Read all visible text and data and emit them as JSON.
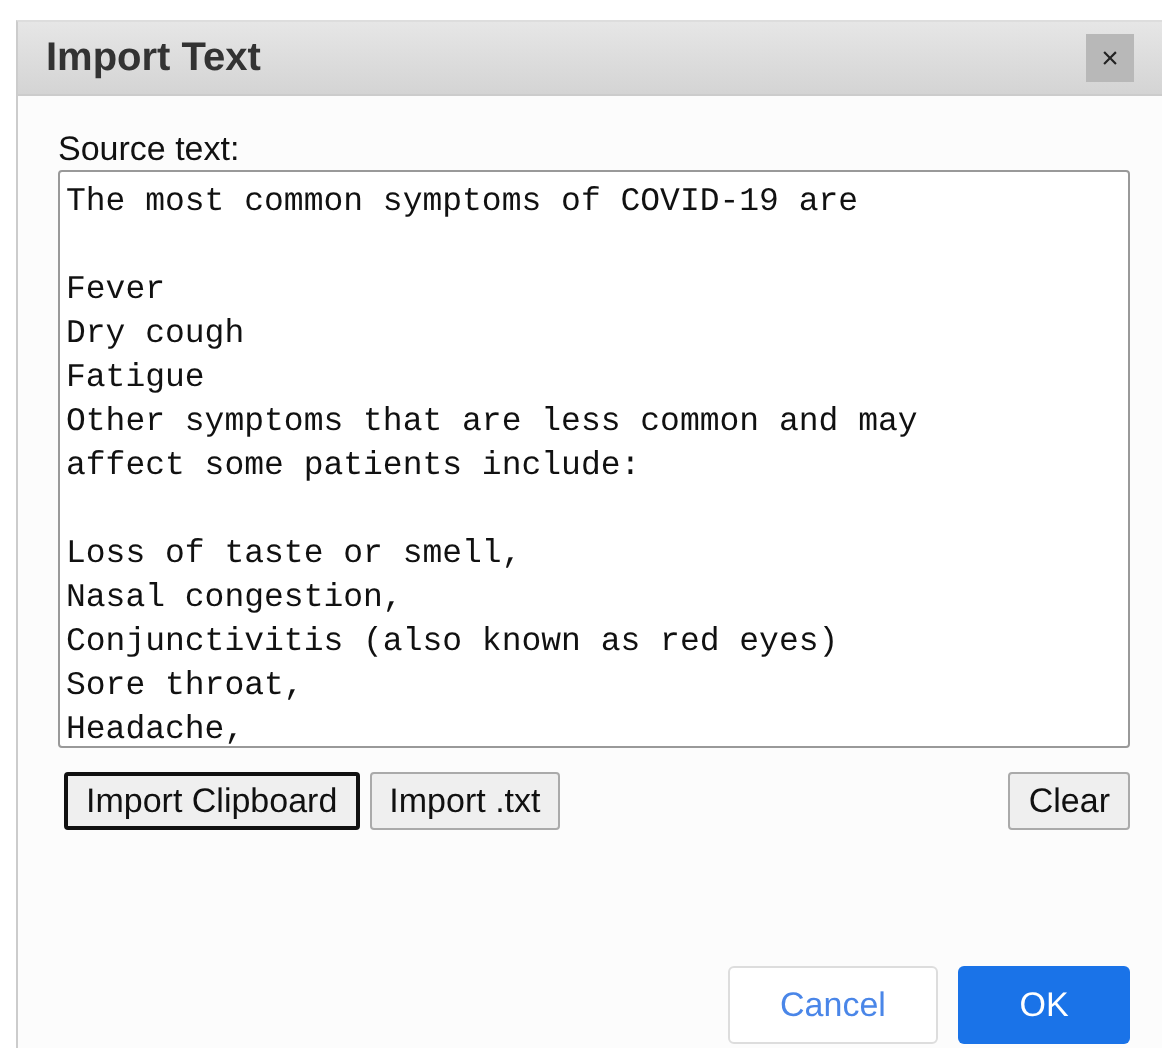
{
  "dialog": {
    "title": "Import Text",
    "close": "×"
  },
  "source": {
    "label": "Source text:",
    "value": "The most common symptoms of COVID-19 are\n\nFever\nDry cough\nFatigue\nOther symptoms that are less common and may\naffect some patients include:\n\nLoss of taste or smell,\nNasal congestion,\nConjunctivitis (also known as red eyes)\nSore throat,\nHeadache,"
  },
  "tools": [
    {
      "label": "Import Clipboard",
      "focused": true,
      "kind": "left"
    },
    {
      "label": "Import .txt",
      "focused": false,
      "kind": "left"
    },
    {
      "label": "Clear",
      "focused": false,
      "kind": "right"
    }
  ],
  "actions": [
    {
      "label": "Cancel",
      "kind": "secondary"
    },
    {
      "label": "OK",
      "kind": "primary"
    }
  ]
}
